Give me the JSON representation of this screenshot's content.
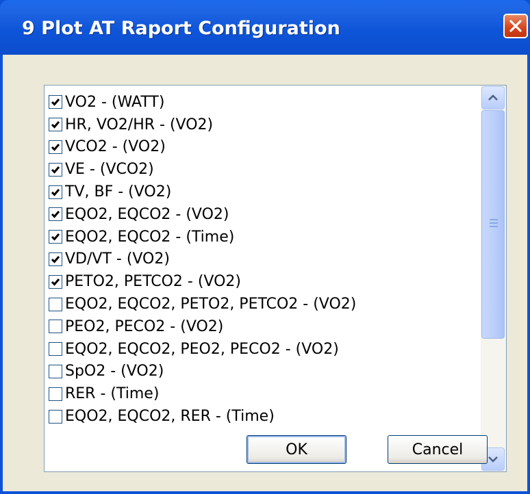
{
  "window": {
    "title": "9 Plot AT Raport Configuration",
    "close_icon": "close-icon"
  },
  "list": {
    "items": [
      {
        "label": "VO2 - (WATT)",
        "checked": true
      },
      {
        "label": "HR, VO2/HR - (VO2)",
        "checked": true
      },
      {
        "label": "VCO2 - (VO2)",
        "checked": true
      },
      {
        "label": "VE - (VCO2)",
        "checked": true
      },
      {
        "label": "TV, BF - (VO2)",
        "checked": true
      },
      {
        "label": "EQO2, EQCO2 - (VO2)",
        "checked": true
      },
      {
        "label": "EQO2, EQCO2 - (Time)",
        "checked": true
      },
      {
        "label": "VD/VT - (VO2)",
        "checked": true
      },
      {
        "label": "PETO2, PETCO2 - (VO2)",
        "checked": true
      },
      {
        "label": "EQO2, EQCO2, PETO2, PETCO2 - (VO2)",
        "checked": false
      },
      {
        "label": "PEO2, PECO2 - (VO2)",
        "checked": false
      },
      {
        "label": "EQO2, EQCO2, PEO2, PECO2 - (VO2)",
        "checked": false
      },
      {
        "label": "SpO2 - (VO2)",
        "checked": false
      },
      {
        "label": "RER - (Time)",
        "checked": false
      },
      {
        "label": "EQO2, EQCO2, RER - (Time)",
        "checked": false
      }
    ]
  },
  "buttons": {
    "ok_label": "OK",
    "cancel_label": "Cancel"
  },
  "colors": {
    "titlebar": "#0b52d8",
    "face": "#ece9d8",
    "check": "#21a121"
  }
}
